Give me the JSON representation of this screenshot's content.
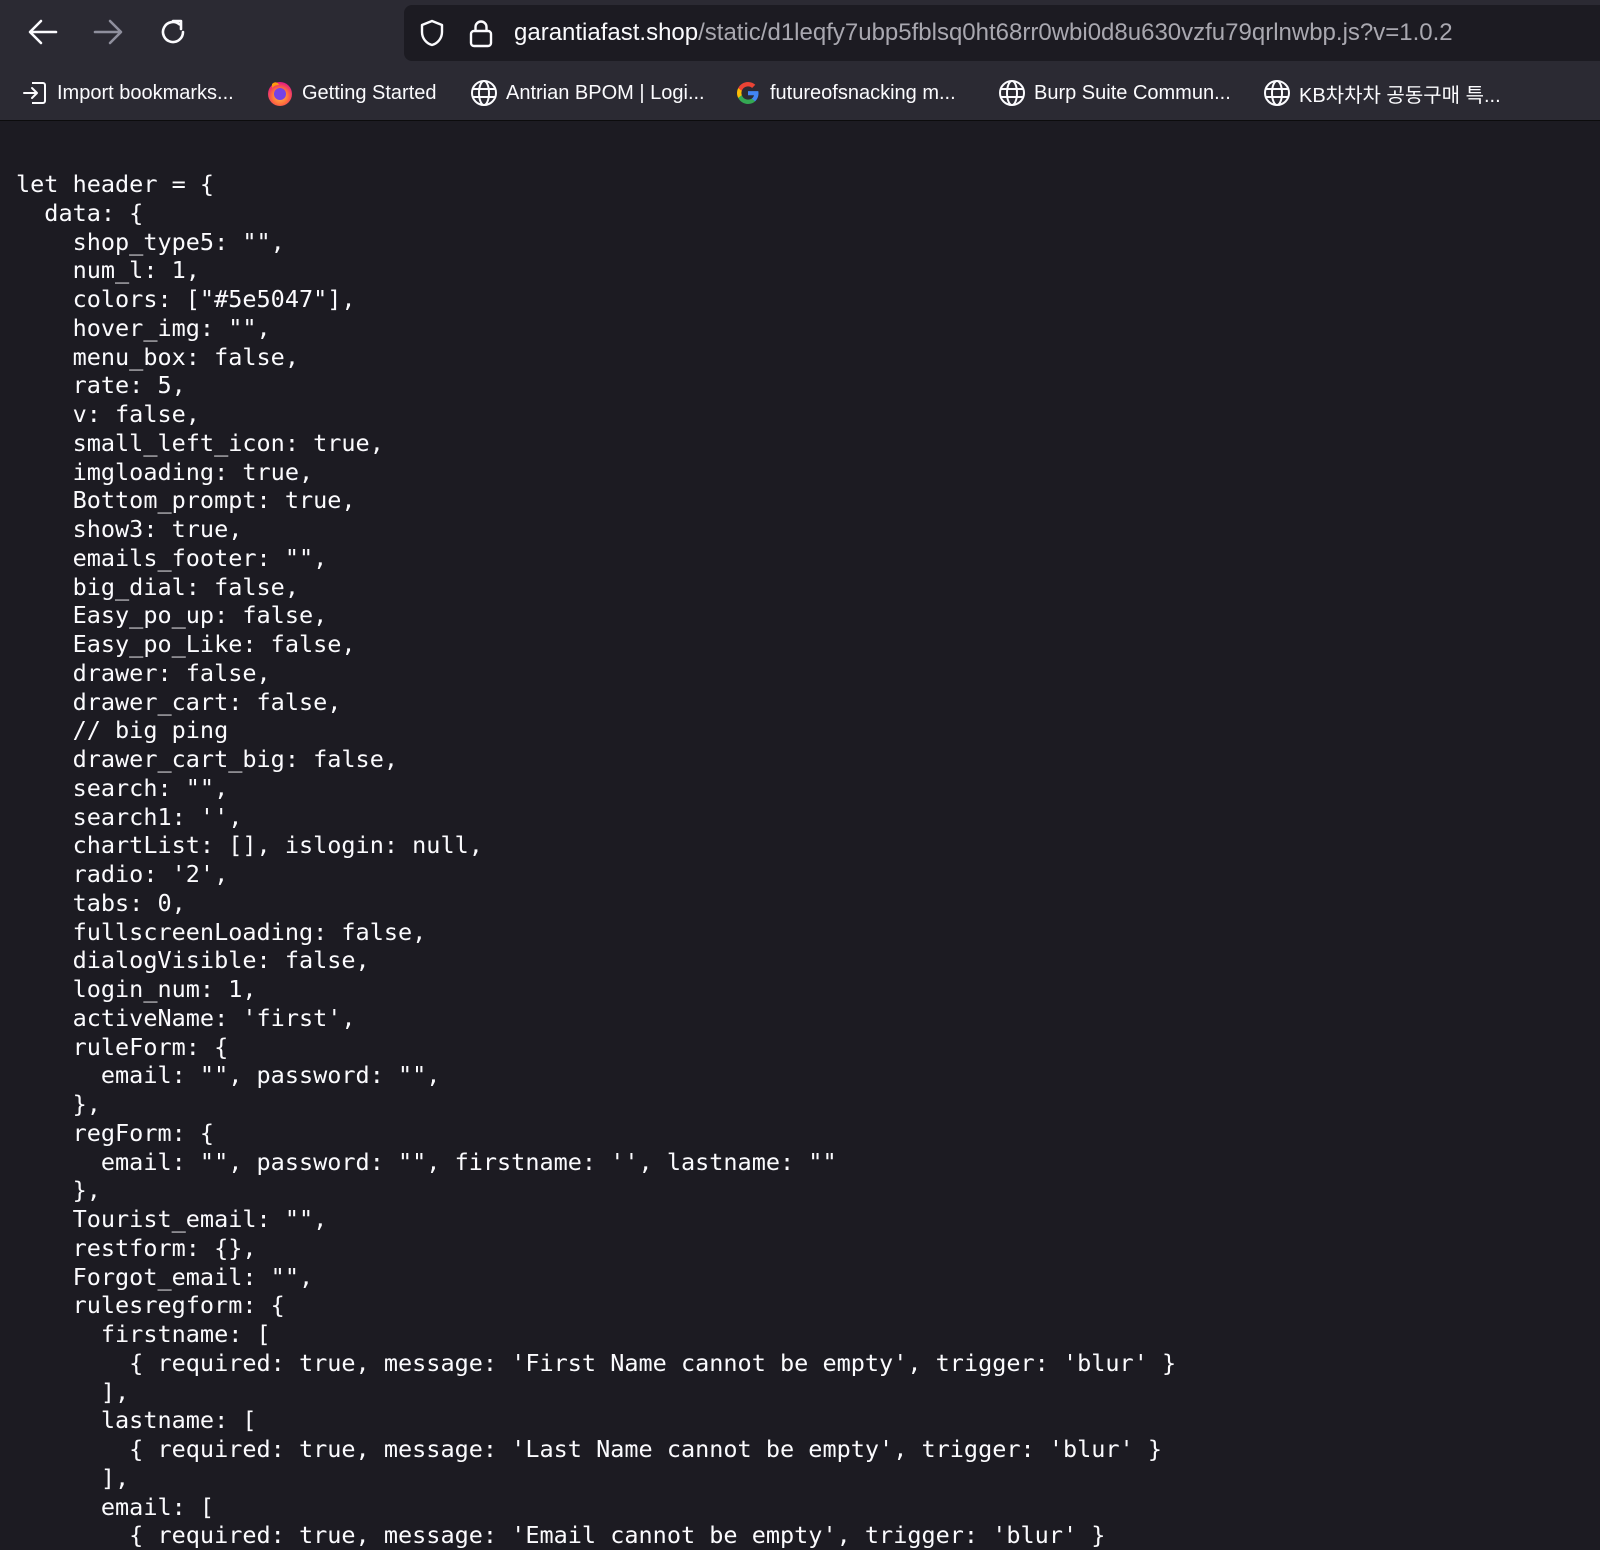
{
  "browser": {
    "url_host": "garantiafast.shop",
    "url_path": "/static/d1leqfy7ubp5fblsq0ht68rr0wbi0d8u630vzfu79qrlnwbp.js?v=1.0.2"
  },
  "bookmarks": [
    {
      "label": "Import bookmarks...",
      "icon": "import-icon"
    },
    {
      "label": "Getting Started",
      "icon": "firefox-icon"
    },
    {
      "label": "Antrian BPOM | Logi...",
      "icon": "globe-icon"
    },
    {
      "label": "futureofsnacking m...",
      "icon": "google-icon"
    },
    {
      "label": "Burp Suite Commun...",
      "icon": "globe-icon"
    },
    {
      "label": "KB차차차 공동구매 특...",
      "icon": "globe-icon"
    }
  ],
  "colors": {
    "chrome_bg": "#2b2a33",
    "page_bg": "#1c1b22",
    "text": "#fbfbfe",
    "url_path": "#a9a8b0"
  },
  "code_lines": [
    "let header = {",
    "  data: {",
    "    shop_type5: \"\",",
    "    num_l: 1,",
    "    colors: [\"#5e5047\"],",
    "    hover_img: \"\",",
    "    menu_box: false,",
    "    rate: 5,",
    "    v: false,",
    "    small_left_icon: true,",
    "    imgloading: true,",
    "    Bottom_prompt: true,",
    "    show3: true,",
    "    emails_footer: \"\",",
    "    big_dial: false,",
    "    Easy_po_up: false,",
    "    Easy_po_Like: false,",
    "    drawer: false,",
    "    drawer_cart: false,",
    "    // big ping",
    "    drawer_cart_big: false,",
    "    search: \"\",",
    "    search1: '',",
    "    chartList: [], islogin: null,",
    "    radio: '2',",
    "    tabs: 0,",
    "    fullscreenLoading: false,",
    "    dialogVisible: false,",
    "    login_num: 1,",
    "    activeName: 'first',",
    "    ruleForm: {",
    "      email: \"\", password: \"\",",
    "    },",
    "    regForm: {",
    "      email: \"\", password: \"\", firstname: '', lastname: \"\"",
    "    },",
    "    Tourist_email: \"\",",
    "    restform: {},",
    "    Forgot_email: \"\",",
    "    rulesregform: {",
    "      firstname: [",
    "        { required: true, message: 'First Name cannot be empty', trigger: 'blur' }",
    "      ],",
    "      lastname: [",
    "        { required: true, message: 'Last Name cannot be empty', trigger: 'blur' }",
    "      ],",
    "      email: [",
    "        { required: true, message: 'Email cannot be empty', trigger: 'blur' }"
  ]
}
